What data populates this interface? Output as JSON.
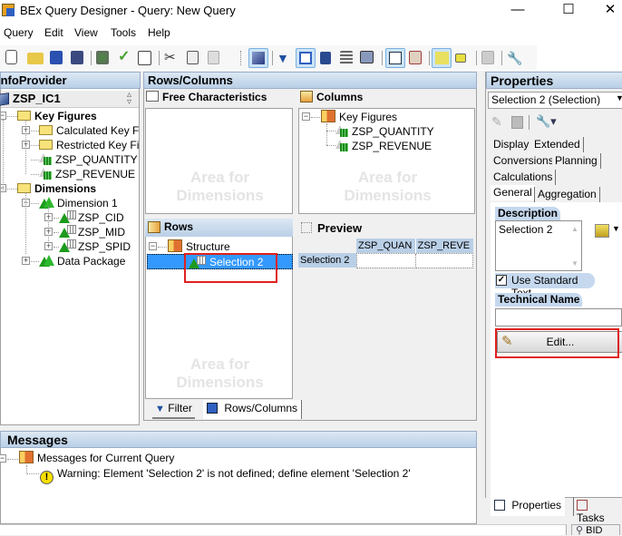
{
  "window": {
    "title": "BEx Query Designer - Query: New Query",
    "controls": {
      "minimize": "—",
      "maximize": "☐",
      "close": "✕"
    }
  },
  "menubar": [
    "Query",
    "Edit",
    "View",
    "Tools",
    "Help"
  ],
  "toolbar": {
    "buttons": [
      {
        "name": "new-query-icon"
      },
      {
        "name": "open-folder-icon"
      },
      {
        "name": "save-icon"
      },
      {
        "name": "save-all-icon"
      },
      {
        "name": "publish-icon"
      },
      {
        "name": "check-query-icon"
      },
      {
        "name": "query-properties-icon"
      },
      {
        "name": "cut-icon"
      },
      {
        "name": "copy-icon"
      },
      {
        "name": "paste-icon"
      },
      {
        "name": "infoprovider-icon",
        "selected": true
      },
      {
        "name": "filter-icon"
      },
      {
        "name": "rows-columns-icon",
        "selected": true
      },
      {
        "name": "cells-icon"
      },
      {
        "name": "conditions-icon"
      },
      {
        "name": "exceptions-icon"
      },
      {
        "name": "properties-icon",
        "selected": true
      },
      {
        "name": "tasks-icon"
      },
      {
        "name": "messages-icon",
        "selected": true
      },
      {
        "name": "where-used-icon"
      },
      {
        "name": "documents-icon"
      },
      {
        "name": "technical-name-icon"
      }
    ]
  },
  "infoprovider": {
    "title": "InfoProvider",
    "provider": "ZSP_IC1",
    "tree": [
      {
        "label": "Key Figures",
        "level": 0,
        "type": "folder-open",
        "bold": true,
        "expander": "−"
      },
      {
        "label": "Calculated Key Figures",
        "level": 1,
        "type": "folder",
        "expander": "+"
      },
      {
        "label": "Restricted Key Figures",
        "level": 1,
        "type": "folder",
        "expander": "+"
      },
      {
        "label": "ZSP_QUANTITY",
        "level": 1,
        "type": "keyfigure"
      },
      {
        "label": "ZSP_REVENUE",
        "level": 1,
        "type": "keyfigure"
      },
      {
        "label": "Dimensions",
        "level": 0,
        "type": "folder-open",
        "bold": true,
        "expander": "−"
      },
      {
        "label": "Dimension 1",
        "level": 1,
        "type": "dimension",
        "expander": "−"
      },
      {
        "label": "ZSP_CID",
        "level": 2,
        "type": "characteristic",
        "expander": "+"
      },
      {
        "label": "ZSP_MID",
        "level": 2,
        "type": "characteristic",
        "expander": "+"
      },
      {
        "label": "ZSP_SPID",
        "level": 2,
        "type": "characteristic",
        "expander": "+"
      },
      {
        "label": "Data Package",
        "level": 1,
        "type": "dimension",
        "expander": "+"
      }
    ]
  },
  "rows_columns": {
    "title": "Rows/Columns",
    "free_characteristics": {
      "title": "Free Characteristics",
      "watermark": [
        "Area for",
        "Dimensions"
      ]
    },
    "columns": {
      "title": "Columns",
      "watermark": [
        "Area for",
        "Dimensions"
      ],
      "tree": [
        {
          "label": "Key Figures",
          "type": "structure",
          "expander": "−"
        },
        {
          "label": "ZSP_QUANTITY",
          "type": "keyfigure"
        },
        {
          "label": "ZSP_REVENUE",
          "type": "keyfigure"
        }
      ]
    },
    "rows": {
      "title": "Rows",
      "watermark": [
        "Area for",
        "Dimensions"
      ],
      "tree": [
        {
          "label": "Structure",
          "type": "structure",
          "expander": "−"
        },
        {
          "label": "Selection 2",
          "type": "selection",
          "selected": true
        }
      ]
    },
    "preview": {
      "title": "Preview",
      "column_headers": [
        "ZSP_QUAN",
        "ZSP_REVE"
      ],
      "row_headers": [
        "Selection 2"
      ]
    },
    "bottom_tabs": [
      {
        "label": "Filter",
        "icon": "filter-icon",
        "active": false
      },
      {
        "label": "Rows/Columns",
        "icon": "rows-columns-icon",
        "active": true
      }
    ]
  },
  "messages": {
    "title": "Messages",
    "root": "Messages for Current Query",
    "items": [
      {
        "type": "warning",
        "text": "Warning: Element 'Selection 2' is not defined; define element 'Selection 2'"
      }
    ]
  },
  "properties": {
    "title": "Properties",
    "selected_object": "Selection 2 (Selection)",
    "tabs_rows": [
      [
        "Display",
        "Extended"
      ],
      [
        "Conversions",
        "Planning"
      ],
      [
        "Calculations"
      ],
      [
        "General",
        "Aggregation"
      ]
    ],
    "active_tab": "General",
    "description_label": "Description",
    "description_value": "Selection 2",
    "use_standard_text_label": "Use Standard Text",
    "use_standard_text_checked": true,
    "technical_name_label": "Technical Name",
    "technical_name_value": "",
    "edit_button": "Edit...",
    "bottom_tabs": [
      {
        "label": "Properties",
        "active": true
      },
      {
        "label": "Tasks",
        "active": false
      }
    ]
  },
  "statusbar": {
    "user": "BID"
  },
  "highlight_color": "#e02020",
  "selection_color": "#3399ff"
}
